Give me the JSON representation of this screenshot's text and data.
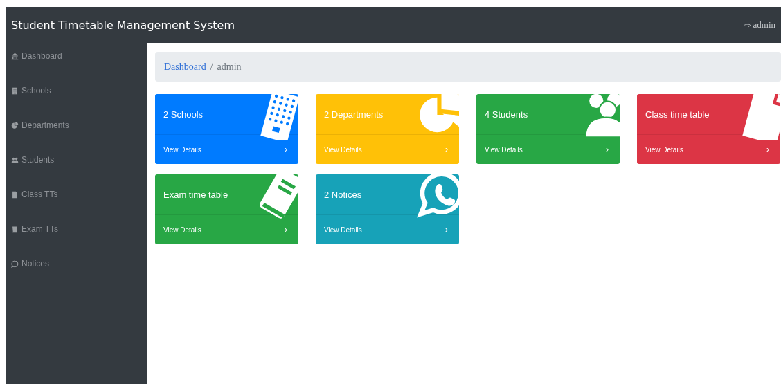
{
  "navbar": {
    "title": "Student Timetable Management System",
    "user_icon": "⇨",
    "user": "admin"
  },
  "sidebar": {
    "items": [
      {
        "kind": "bank",
        "label": "Dashboard"
      },
      {
        "kind": "building",
        "label": "Schools"
      },
      {
        "kind": "pie",
        "label": "Departments"
      },
      {
        "kind": "users",
        "label": "Students"
      },
      {
        "kind": "file",
        "label": "Class TTs"
      },
      {
        "kind": "book",
        "label": "Exam TTs"
      },
      {
        "kind": "chat",
        "label": "Notices"
      }
    ]
  },
  "breadcrumb": [
    {
      "label": "Dashboard",
      "link": true
    },
    {
      "label": "admin",
      "link": false
    }
  ],
  "breadcrumb_separator": "/",
  "cards": [
    {
      "title": "2 Schools",
      "kind": "building",
      "color": "#007bff",
      "footer": "View Details",
      "chevron": "›"
    },
    {
      "title": "2 Departments",
      "kind": "pie",
      "color": "#ffc107",
      "footer": "View Details",
      "chevron": "›"
    },
    {
      "title": "4 Students",
      "kind": "users",
      "color": "#28a745",
      "footer": "View Details",
      "chevron": "›"
    },
    {
      "title": "Class time table",
      "kind": "file",
      "color": "#dc3545",
      "footer": "View Details",
      "chevron": "›"
    },
    {
      "title": "Exam time table",
      "kind": "book",
      "color": "#28a745",
      "footer": "View Details",
      "chevron": "›"
    },
    {
      "title": "2 Notices",
      "kind": "chat",
      "color": "#17a2b8",
      "footer": "View Details",
      "chevron": "›"
    }
  ]
}
